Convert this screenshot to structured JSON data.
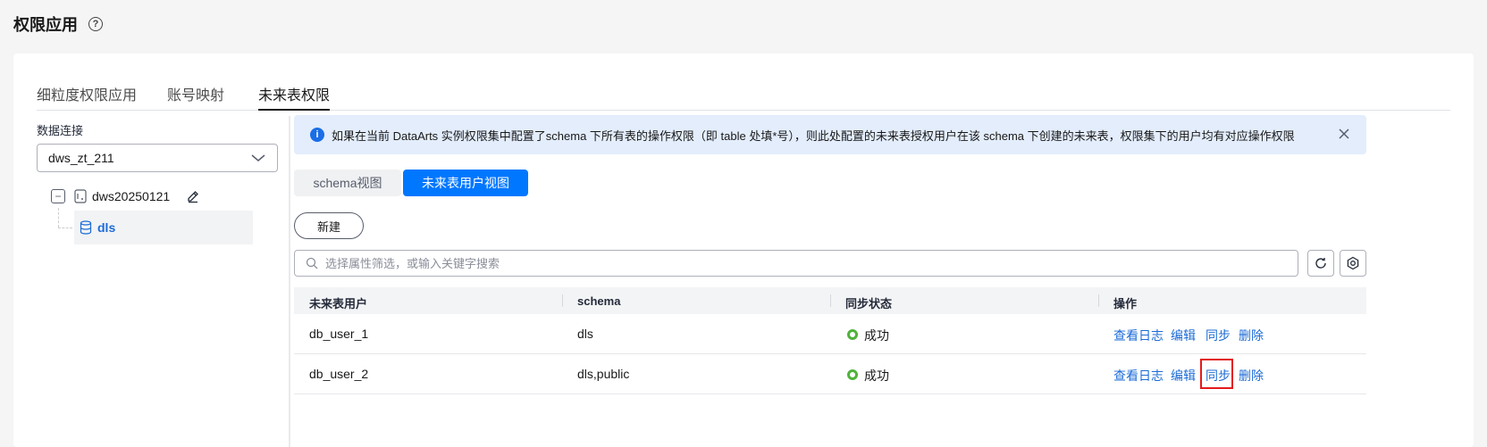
{
  "page": {
    "title": "权限应用"
  },
  "tabs": [
    {
      "label": "细粒度权限应用"
    },
    {
      "label": "账号映射"
    },
    {
      "label": "未来表权限"
    }
  ],
  "left": {
    "conn_label": "数据连接",
    "conn_value": "dws_zt_211",
    "tree": {
      "root": "dws20250121",
      "child": "dls"
    }
  },
  "alert": {
    "text": "如果在当前 DataArts 实例权限集中配置了schema 下所有表的操作权限（即 table 处填*号），则此处配置的未来表授权用户在该 schema 下创建的未来表，权限集下的用户均有对应操作权限"
  },
  "views": {
    "schema": "schema视图",
    "user": "未来表用户视图"
  },
  "new_button": "新建",
  "search": {
    "placeholder": "选择属性筛选，或输入关键字搜索"
  },
  "table": {
    "headers": [
      "未来表用户",
      "schema",
      "同步状态",
      "操作"
    ],
    "rows": [
      {
        "user": "db_user_1",
        "schema": "dls",
        "status": "成功"
      },
      {
        "user": "db_user_2",
        "schema": "dls,public",
        "status": "成功"
      }
    ],
    "actions": {
      "log": "查看日志",
      "edit": "编辑",
      "sync": "同步",
      "delete": "删除"
    }
  },
  "colors": {
    "primary": "#0077ff",
    "link": "#1c6bd6",
    "success": "#50b23c",
    "highlight": "#e31a1a"
  }
}
